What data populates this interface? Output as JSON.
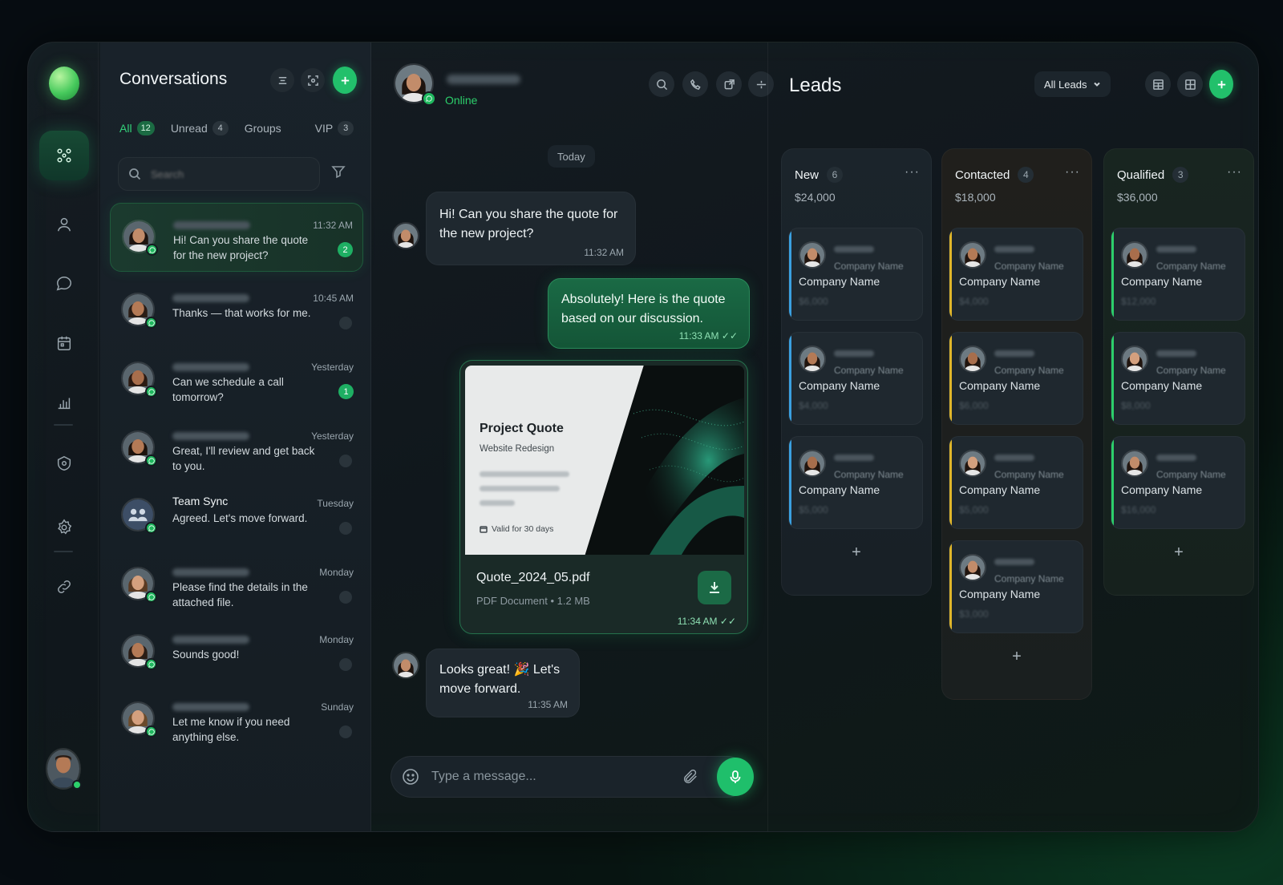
{
  "rail": {
    "items": [
      "apps",
      "contacts",
      "chats",
      "calendar",
      "analytics",
      "security",
      "settings",
      "integrations"
    ]
  },
  "conversations": {
    "title": "Conversations",
    "tabs": [
      {
        "label": "All",
        "count": "12"
      },
      {
        "label": "Unread",
        "count": "4"
      },
      {
        "label": "Groups",
        "count": ""
      },
      {
        "label": "VIP",
        "count": "3"
      }
    ],
    "search_placeholder": "Search",
    "items": [
      {
        "name": "",
        "message": "Hi! Can you share the quote for the new project?",
        "time": "11:32 AM",
        "unread": "2"
      },
      {
        "name": "",
        "message": "Thanks — that works for me.",
        "time": "10:45 AM",
        "unread": ""
      },
      {
        "name": "",
        "message": "Can we schedule a call tomorrow?",
        "time": "Yesterday",
        "unread": "1"
      },
      {
        "name": "",
        "message": "Great, I'll review and get back to you.",
        "time": "Yesterday",
        "unread": ""
      },
      {
        "name": "Team Sync",
        "message": "Agreed. Let's move forward.",
        "time": "Tuesday",
        "unread": ""
      },
      {
        "name": "",
        "message": "Please find the details in the attached file.",
        "time": "Monday",
        "unread": ""
      },
      {
        "name": "",
        "message": "Sounds good!",
        "time": "Monday",
        "unread": ""
      },
      {
        "name": "",
        "message": "Let me know if you need anything else.",
        "time": "Sunday",
        "unread": ""
      }
    ]
  },
  "chat": {
    "status": "Online",
    "date_separator": "Today",
    "messages": [
      {
        "direction": "in",
        "text": "Hi! Can you share the quote for the new project?",
        "time": "11:32 AM"
      },
      {
        "direction": "out",
        "text": "Absolutely! Here is the quote based on our discussion.",
        "time": "11:33 AM"
      },
      {
        "direction": "in",
        "text": "Looks great! 🎉 Let's move forward.",
        "time": "11:35 AM"
      }
    ],
    "file": {
      "preview_title": "Project Quote",
      "preview_subtitle": "Website Redesign",
      "preview_note": "Valid for 30 days",
      "name": "Quote_2024_05.pdf",
      "meta": "PDF Document • 1.2 MB",
      "time": "11:34 AM"
    },
    "composer_placeholder": "Type a message..."
  },
  "leads": {
    "title": "Leads",
    "filter": "All Leads",
    "columns": [
      {
        "name": "New",
        "count": "6",
        "total": "$24,000",
        "accent": "#3aa0e0",
        "cards": [
          {
            "company_small": "Company Name",
            "company": "Company Name",
            "amount": "$6,000"
          },
          {
            "company_small": "Company Name",
            "company": "Company Name",
            "amount": "$4,000"
          },
          {
            "company_small": "Company Name",
            "company": "Company Name",
            "amount": "$5,000"
          }
        ]
      },
      {
        "name": "Contacted",
        "count": "4",
        "total": "$18,000",
        "accent": "#e0b62a",
        "cards": [
          {
            "company_small": "Company Name",
            "company": "Company Name",
            "amount": "$4,000"
          },
          {
            "company_small": "Company Name",
            "company": "Company Name",
            "amount": "$6,000"
          },
          {
            "company_small": "Company Name",
            "company": "Company Name",
            "amount": "$5,000"
          },
          {
            "company_small": "Company Name",
            "company": "Company Name",
            "amount": "$3,000"
          }
        ]
      },
      {
        "name": "Qualified",
        "count": "3",
        "total": "$36,000",
        "accent": "#2ccf6b",
        "cards": [
          {
            "company_small": "Company Name",
            "company": "Company Name",
            "amount": "$12,000"
          },
          {
            "company_small": "Company Name",
            "company": "Company Name",
            "amount": "$8,000"
          },
          {
            "company_small": "Company Name",
            "company": "Company Name",
            "amount": "$16,000"
          }
        ]
      }
    ],
    "add_symbol": "+"
  },
  "colors": {
    "accent": "#22c06b",
    "background": "#0b1115"
  }
}
